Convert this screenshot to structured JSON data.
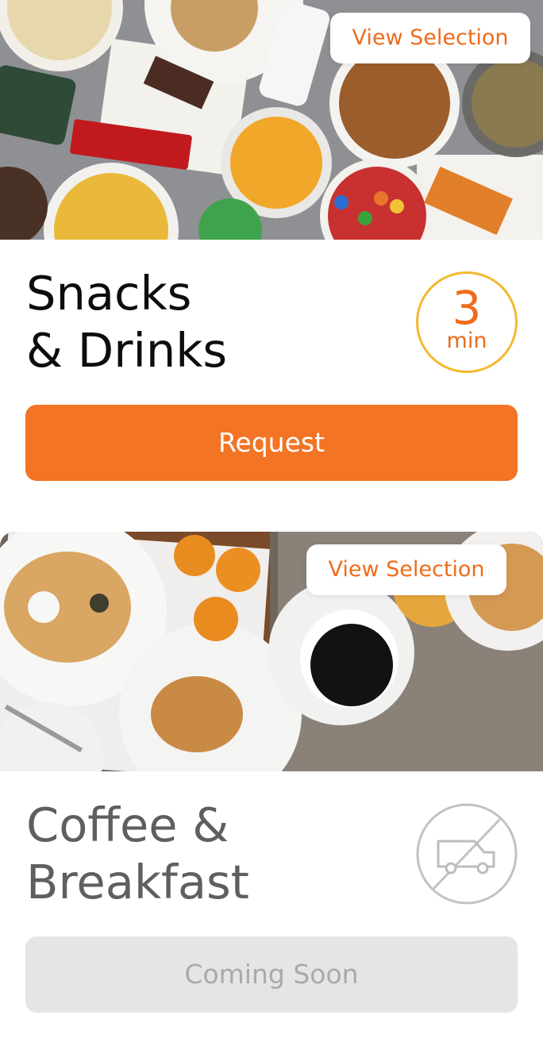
{
  "cards": [
    {
      "view_label": "View Selection",
      "title_line1": "Snacks",
      "title_line2": "& Drinks",
      "eta_value": "3",
      "eta_unit": "min",
      "action_label": "Request",
      "available": true,
      "icon": "eta-circle"
    },
    {
      "view_label": "View Selection",
      "title_line1": "Coffee &",
      "title_line2": "Breakfast",
      "action_label": "Coming Soon",
      "available": false,
      "icon": "no-delivery-van-icon"
    }
  ],
  "colors": {
    "accent": "#f27424",
    "accent_text": "#ee6c1b",
    "badge_ring": "#f5b82e",
    "disabled_bg": "#e6e5e3",
    "disabled_text": "#a9a9a9"
  }
}
